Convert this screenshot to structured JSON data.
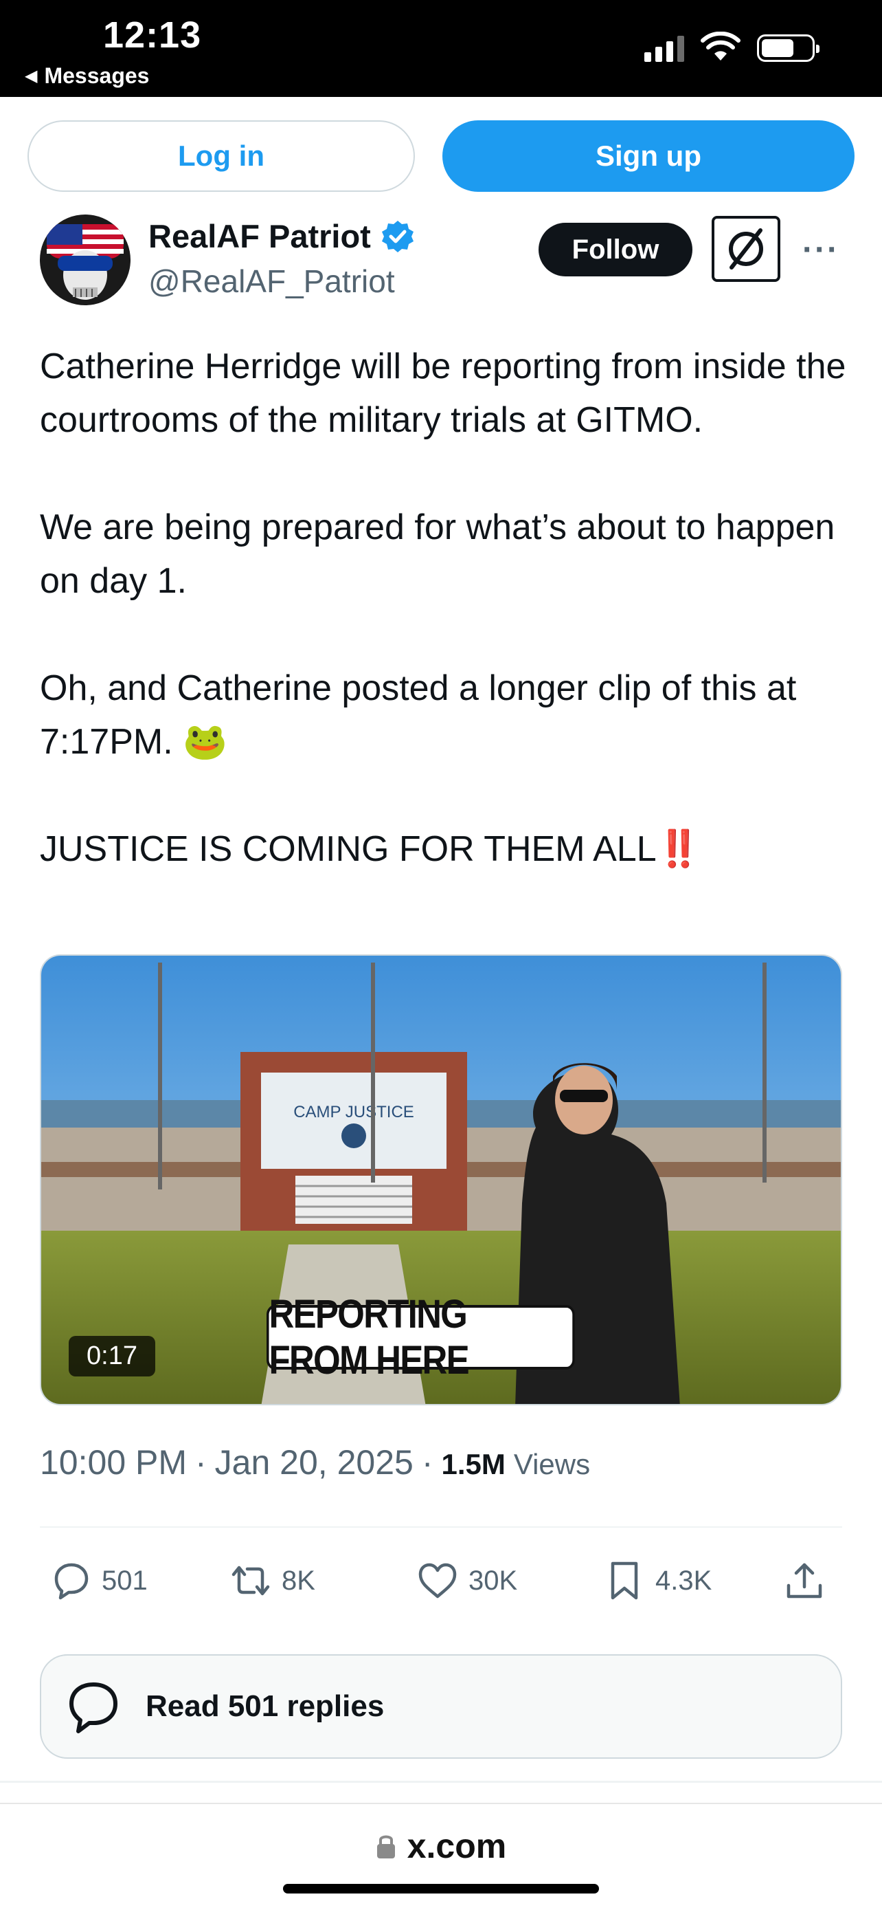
{
  "status_bar": {
    "time": "12:13",
    "back_label": "Messages",
    "icons": [
      "cellular-signal-icon",
      "wifi-icon",
      "battery-icon"
    ]
  },
  "auth": {
    "login_label": "Log in",
    "signup_label": "Sign up"
  },
  "author": {
    "name": "RealAF Patriot",
    "handle": "@RealAF_Patriot",
    "verified": true,
    "follow_label": "Follow"
  },
  "tweet": {
    "paragraphs": [
      "Catherine Herridge will be reporting from inside the courtrooms of the military trials at GITMO.",
      "We are being prepared for what’s about to happen on day 1.",
      "Oh, and Catherine posted a longer clip of this at 7:17PM. 🐸",
      "JUSTICE IS COMING FOR THEM ALL‼️"
    ],
    "media": {
      "duration": "0:17",
      "caption": "REPORTING FROM HERE",
      "sign_text": "CAMP JUSTICE"
    },
    "time": "10:00 PM",
    "date": "Jan 20, 2025",
    "views_count": "1.5M",
    "views_label": "Views"
  },
  "actions": {
    "replies": "501",
    "reposts": "8K",
    "likes": "30K",
    "bookmarks": "4.3K"
  },
  "read_replies_label": "Read 501 replies",
  "url_bar": {
    "domain": "x.com"
  },
  "colors": {
    "accent": "#1d9bf0",
    "text_primary": "#0f1419",
    "text_secondary": "#536471",
    "border": "#cfd9de"
  }
}
